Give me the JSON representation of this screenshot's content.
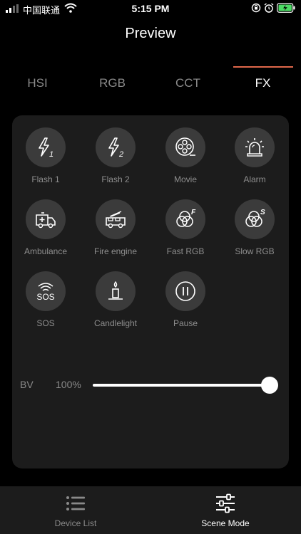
{
  "status_bar": {
    "carrier": "中国联通",
    "time": "5:15 PM"
  },
  "header": {
    "title": "Preview"
  },
  "tabs": [
    {
      "label": "HSI",
      "active": false
    },
    {
      "label": "RGB",
      "active": false
    },
    {
      "label": "CCT",
      "active": false
    },
    {
      "label": "FX",
      "active": true
    }
  ],
  "effects": [
    {
      "label": "Flash 1",
      "icon": "flash-1-icon"
    },
    {
      "label": "Flash 2",
      "icon": "flash-2-icon"
    },
    {
      "label": "Movie",
      "icon": "film-reel-icon"
    },
    {
      "label": "Alarm",
      "icon": "alarm-siren-icon"
    },
    {
      "label": "Ambulance",
      "icon": "ambulance-icon"
    },
    {
      "label": "Fire engine",
      "icon": "fire-engine-icon"
    },
    {
      "label": "Fast RGB",
      "icon": "rgb-circles-f-icon"
    },
    {
      "label": "Slow RGB",
      "icon": "rgb-circles-s-icon"
    },
    {
      "label": "SOS",
      "icon": "sos-icon"
    },
    {
      "label": "Candlelight",
      "icon": "candle-icon"
    },
    {
      "label": "Pause",
      "icon": "pause-icon"
    }
  ],
  "brightness": {
    "label": "BV",
    "value": "100%",
    "level": 1.0
  },
  "bottom_nav": [
    {
      "label": "Device List",
      "icon": "list-icon",
      "active": false
    },
    {
      "label": "Scene Mode",
      "icon": "sliders-icon",
      "active": true
    }
  ],
  "colors": {
    "accent": "#e0674a",
    "panel": "#1c1c1c",
    "icon_circle": "#3b3b3b",
    "muted_text": "#8a8a8a"
  }
}
